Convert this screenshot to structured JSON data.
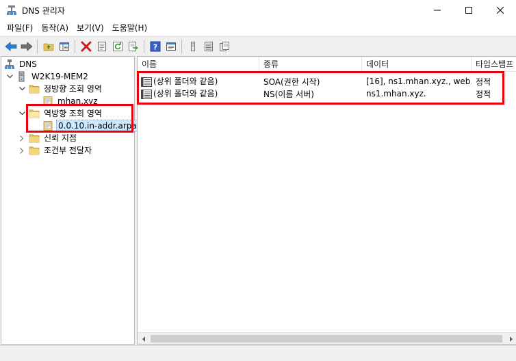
{
  "window": {
    "title": "DNS 관리자",
    "minimize_glyph": "—",
    "maximize_glyph": "☐",
    "close_glyph": "✕"
  },
  "menu": [
    "파일(F)",
    "동작(A)",
    "보기(V)",
    "도움말(H)"
  ],
  "toolbar": {
    "buttons": [
      "back-arrow-icon",
      "forward-arrow-icon",
      "up-folder-icon",
      "show-hide-tree-icon",
      "delete-icon",
      "properties-icon",
      "refresh-icon",
      "export-list-icon",
      "help-icon",
      "console-view-icon",
      "new-record-icon",
      "list-icon",
      "copy-icon"
    ]
  },
  "tree": {
    "root": "DNS",
    "server": "W2K19-MEM2",
    "forward_zones": "정방향 조회 영역",
    "forward_zone_item": "mhan.xyz",
    "reverse_zones": "역방향 조회 영역",
    "reverse_zone_item": "0.0.10.in-addr.arpa",
    "trust_points": "신뢰 지점",
    "conditional_forwarders": "조건부 전달자"
  },
  "list": {
    "columns": [
      "이름",
      "종류",
      "데이터",
      "타임스탬프"
    ],
    "rows": [
      {
        "name": "(상위 폴더와 같음)",
        "type": "SOA(권한 시작)",
        "data": "[16], ns1.mhan.xyz., web.",
        "timestamp": "정적"
      },
      {
        "name": "(상위 폴더와 같음)",
        "type": "NS(이름 서버)",
        "data": "ns1.mhan.xyz.",
        "timestamp": "정적"
      }
    ]
  },
  "colors": {
    "highlight": "#e8000b",
    "selection": "#cce8ff",
    "folder": "#e8c25c"
  }
}
